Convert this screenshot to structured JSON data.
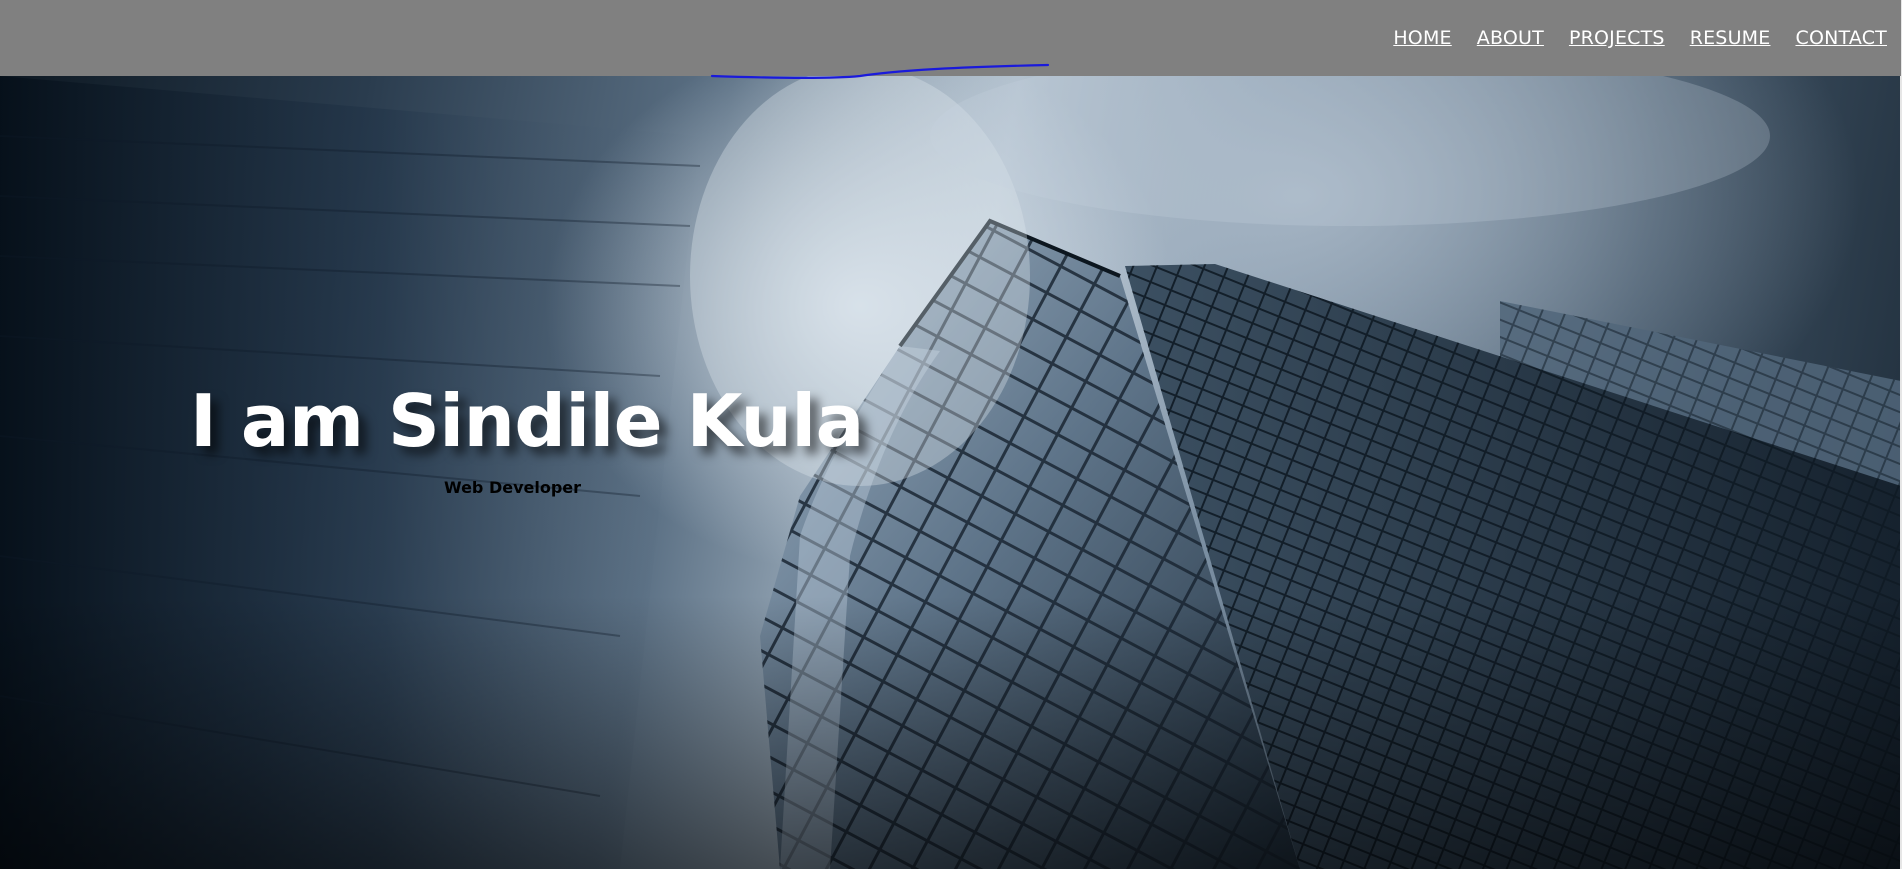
{
  "nav": {
    "items": [
      {
        "label": "HOME"
      },
      {
        "label": "ABOUT"
      },
      {
        "label": "PROJECTS"
      },
      {
        "label": "RESUME"
      },
      {
        "label": "CONTACT"
      }
    ]
  },
  "hero": {
    "title": "I am Sindile Kula",
    "subtitle": "Web Developer",
    "background_image": "city-skyscraper-photo"
  },
  "colors": {
    "navbar": "#808080",
    "nav_text": "#ffffff",
    "title_text": "#ffffff",
    "subtitle_text": "#000000",
    "pen_stroke": "#1a1adb"
  }
}
